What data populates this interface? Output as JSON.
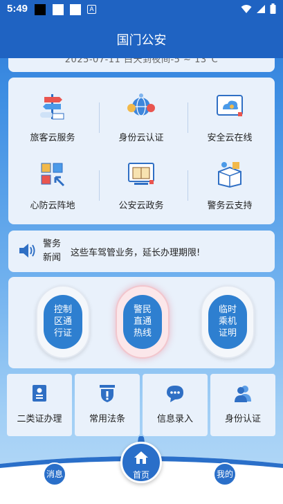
{
  "status_bar": {
    "time": "5:49",
    "badge_letter": "A"
  },
  "header": {
    "title": "国门公安"
  },
  "date_strip": {
    "text": "2025-07-11   白天到夜间-5 ~ 13°C"
  },
  "services": [
    {
      "label": "旅客云服务",
      "icon": "signpost-icon"
    },
    {
      "label": "身份云认证",
      "icon": "identity-globe-icon"
    },
    {
      "label": "安全云在线",
      "icon": "cloud-monitor-icon"
    },
    {
      "label": "心防云阵地",
      "icon": "cubes-icon"
    },
    {
      "label": "公安云政务",
      "icon": "book-screen-icon"
    },
    {
      "label": "警务云支持",
      "icon": "box-support-icon"
    }
  ],
  "news": {
    "tag_line1": "警务",
    "tag_line2": "新闻",
    "headline": "这些车驾管业务，延长办理期限!"
  },
  "capsules": [
    {
      "l1": "控制",
      "l2": "区通",
      "l3": "行证"
    },
    {
      "l1": "警民",
      "l2": "直通",
      "l3": "热线"
    },
    {
      "l1": "临时",
      "l2": "乘机",
      "l3": "证明"
    }
  ],
  "quick": [
    {
      "label": "二类证办理",
      "icon": "id-card-icon"
    },
    {
      "label": "常用法条",
      "icon": "shield-badge-icon"
    },
    {
      "label": "信息录入",
      "icon": "chat-bubble-icon"
    },
    {
      "label": "身份认证",
      "icon": "users-icon"
    }
  ],
  "nav": {
    "left": "消息",
    "center": "首页",
    "right": "我的"
  },
  "colors": {
    "primary": "#1f63c2",
    "card": "#e9f1fb",
    "capsule": "#2e7fd0"
  }
}
